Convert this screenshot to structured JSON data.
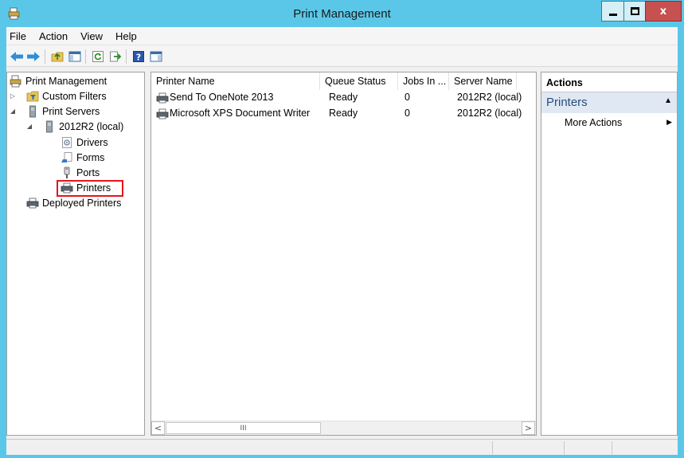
{
  "window": {
    "title": "Print Management",
    "close_glyph": "x",
    "colors": {
      "titlebar": "#5bc7e8",
      "close_button": "#c75050",
      "highlight": "#e8141c"
    }
  },
  "menu": {
    "items": [
      "File",
      "Action",
      "View",
      "Help"
    ]
  },
  "toolbar": {
    "icons": [
      "back-arrow-icon",
      "forward-arrow-icon",
      "up-folder-icon",
      "show-hide-tree-icon",
      "refresh-icon",
      "export-list-icon",
      "help-icon",
      "show-hide-action-pane-icon"
    ]
  },
  "tree": {
    "root": "Print Management",
    "custom_filters": "Custom Filters",
    "print_servers": "Print Servers",
    "server": "2012R2 (local)",
    "drivers": "Drivers",
    "forms": "Forms",
    "ports": "Ports",
    "printers": "Printers",
    "deployed_printers": "Deployed Printers"
  },
  "list": {
    "columns": [
      "Printer Name",
      "Queue Status",
      "Jobs In ...",
      "Server Name"
    ],
    "rows": [
      {
        "name": "Send To OneNote 2013",
        "status": "Ready",
        "jobs": "0",
        "server": "2012R2 (local)"
      },
      {
        "name": "Microsoft XPS Document Writer",
        "status": "Ready",
        "jobs": "0",
        "server": "2012R2 (local)"
      }
    ],
    "scroll_left": "<",
    "scroll_right": ">",
    "thumb_grip": "III"
  },
  "actions": {
    "title": "Actions",
    "group": "Printers",
    "more": "More Actions"
  }
}
